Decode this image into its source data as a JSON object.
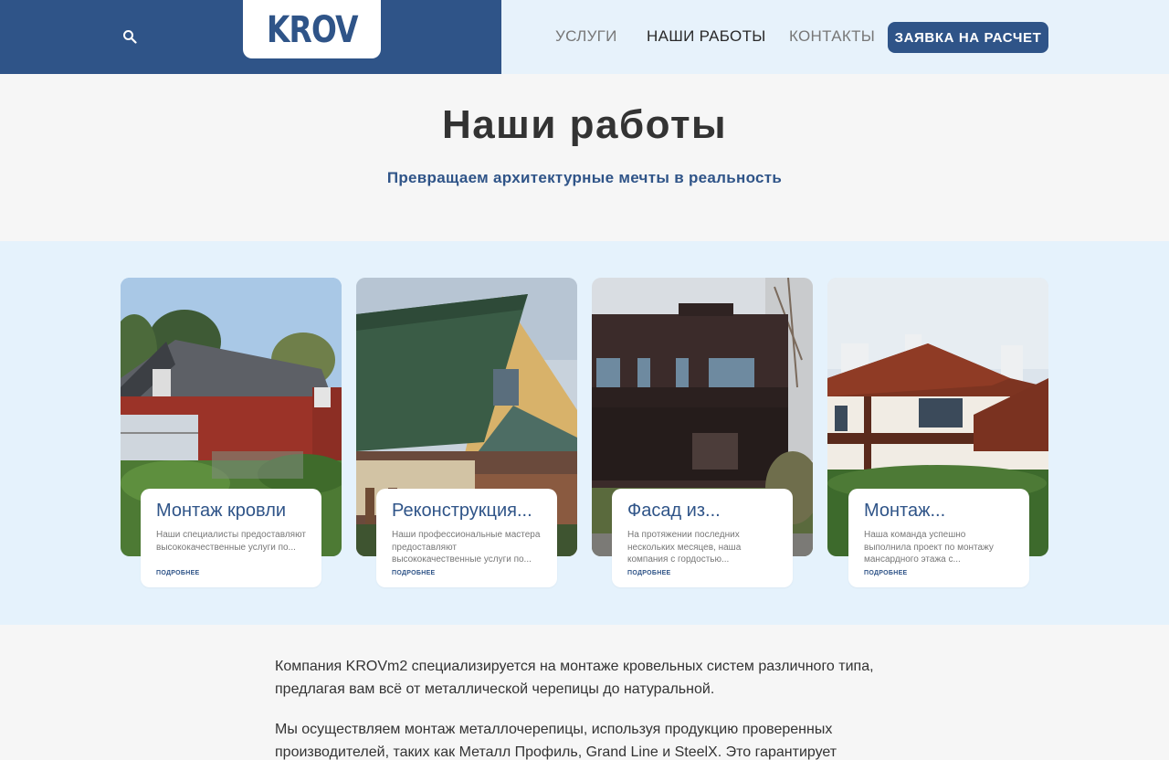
{
  "header": {
    "logo": "KROV",
    "nav": [
      "УСЛУГИ",
      "НАШИ РАБОТЫ",
      "КОНТАКТЫ"
    ],
    "active_nav": "НАШИ РАБОТЫ",
    "cta": "ЗАЯВКА НА РАСЧЕТ",
    "search_icon": "search-icon"
  },
  "hero": {
    "title": "Наши работы",
    "subtitle": "Превращаем архитектурные мечты в реальность"
  },
  "works": [
    {
      "title": "Монтаж кровли",
      "text": "Наши специалисты предоставляют высококачественные услуги по...",
      "more": "ПОДРОБНЕЕ"
    },
    {
      "title": "Реконструкция...",
      "text": "Наши профессиональные мастера предоставляют высококачественные услуги по...",
      "more": "ПОДРОБНЕЕ"
    },
    {
      "title": "Фасад из...",
      "text": "На протяжении последних нескольких месяцев, наша компания с гордостью...",
      "more": "ПОДРОБНЕЕ"
    },
    {
      "title": "Монтаж...",
      "text": "Наша команда успешно выполнила проект по монтажу мансардного этажа с...",
      "more": "ПОДРОБНЕЕ"
    }
  ],
  "content": {
    "p1": "Компания KROVm2 специализируется на монтаже кровельных систем различного типа, предлагая вам всё от металлической черепицы до натуральной.",
    "p2": "Мы осуществляем монтаж металлочерепицы, используя продукцию проверенных производителей, таких как Металл Профиль, Grand Line и SteelX. Это гарантирует"
  },
  "colors": {
    "brand": "#2f5488",
    "header_bg": "#e7f2fb",
    "section_bg": "#e5f2fc"
  }
}
